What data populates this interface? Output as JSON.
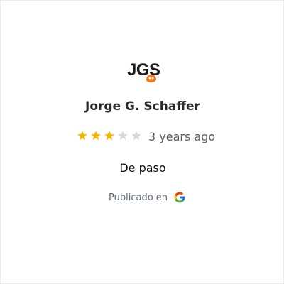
{
  "reviewer": {
    "initials_logo": "JGS",
    "name": "Jorge G. Schaffer"
  },
  "rating": {
    "value": 3,
    "max": 5,
    "filled_color": "#f7b500",
    "empty_color": "#d9d9d9"
  },
  "review": {
    "time_ago": "3 years ago",
    "text": "De paso"
  },
  "source": {
    "label": "Publicado en",
    "icon": "google-icon"
  }
}
